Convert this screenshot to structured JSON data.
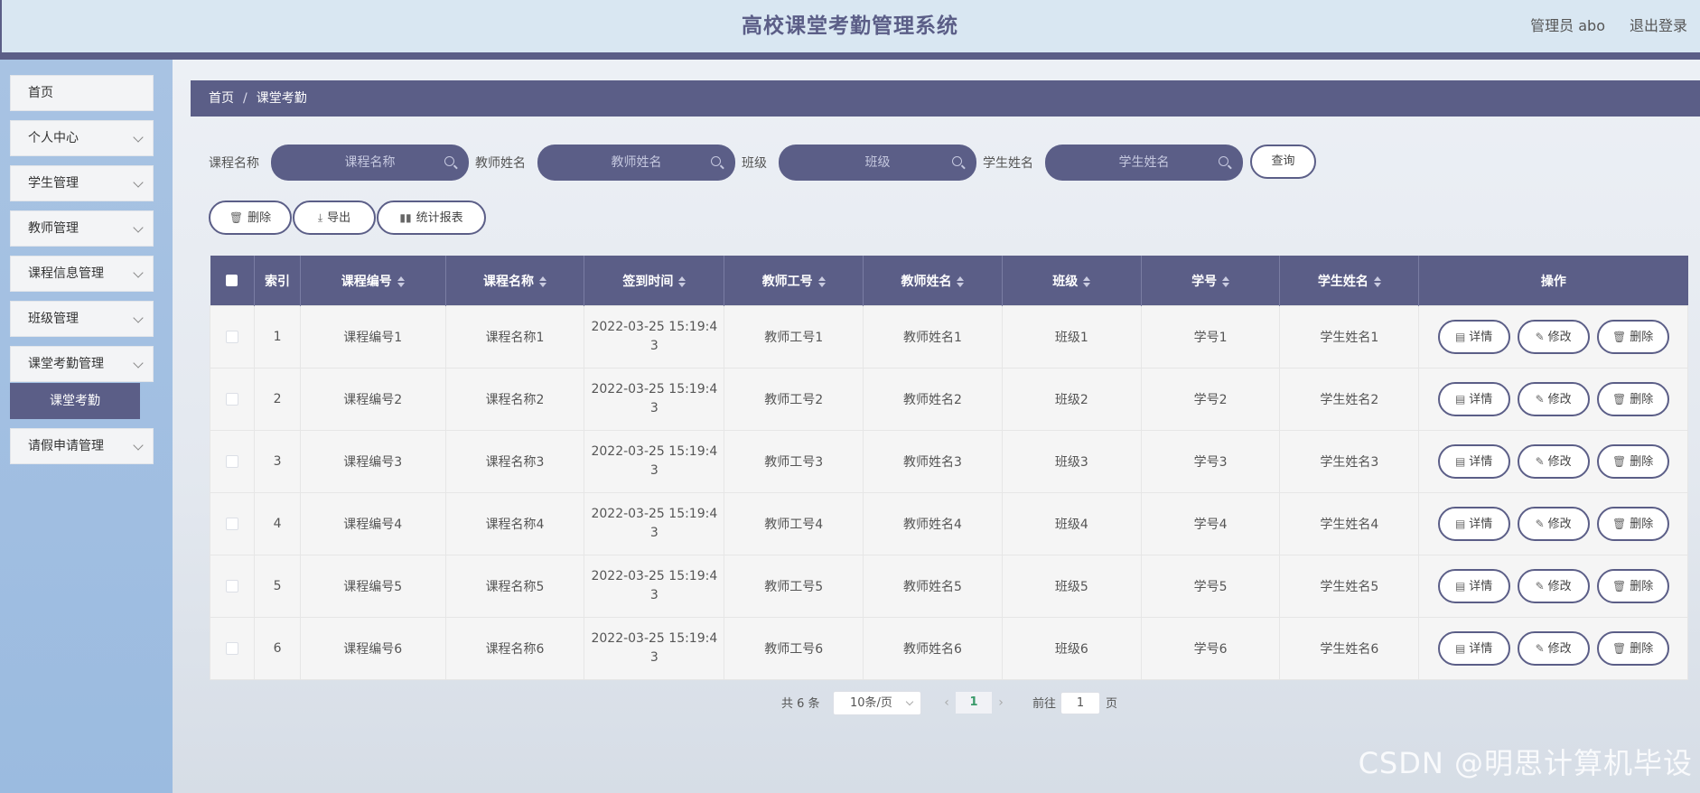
{
  "header": {
    "title": "高校课堂考勤管理系统",
    "admin": "管理员 abo",
    "logout": "退出登录"
  },
  "sidebar": {
    "items": [
      {
        "label": "首页",
        "has_arrow": false
      },
      {
        "label": "个人中心",
        "has_arrow": true
      },
      {
        "label": "学生管理",
        "has_arrow": true
      },
      {
        "label": "教师管理",
        "has_arrow": true
      },
      {
        "label": "课程信息管理",
        "has_arrow": true
      },
      {
        "label": "班级管理",
        "has_arrow": true
      },
      {
        "label": "课堂考勤管理",
        "has_arrow": true
      },
      {
        "label": "请假申请管理",
        "has_arrow": true
      }
    ],
    "sub_active": "课堂考勤"
  },
  "breadcrumb": {
    "home": "首页",
    "separator": "/",
    "current": "课堂考勤"
  },
  "search": {
    "course_name_label": "课程名称",
    "course_name_placeholder": "课程名称",
    "teacher_name_label": "教师姓名",
    "teacher_name_placeholder": "教师姓名",
    "class_label": "班级",
    "class_placeholder": "班级",
    "student_name_label": "学生姓名",
    "student_name_placeholder": "学生姓名",
    "query_button": "查询"
  },
  "actions": {
    "delete": "删除",
    "export": "导出",
    "report": "统计报表"
  },
  "table": {
    "headers": {
      "index": "索引",
      "course_code": "课程编号",
      "course_name": "课程名称",
      "signin_time": "签到时间",
      "teacher_id": "教师工号",
      "teacher_name": "教师姓名",
      "class": "班级",
      "student_id": "学号",
      "student_name": "学生姓名",
      "ops": "操作"
    },
    "rows": [
      {
        "index": "1",
        "course_code": "课程编号1",
        "course_name": "课程名称1",
        "time_a": "2022-03-25 15:19:4",
        "time_b": "3",
        "teacher_id": "教师工号1",
        "teacher_name": "教师姓名1",
        "class": "班级1",
        "student_id": "学号1",
        "student_name": "学生姓名1"
      },
      {
        "index": "2",
        "course_code": "课程编号2",
        "course_name": "课程名称2",
        "time_a": "2022-03-25 15:19:4",
        "time_b": "3",
        "teacher_id": "教师工号2",
        "teacher_name": "教师姓名2",
        "class": "班级2",
        "student_id": "学号2",
        "student_name": "学生姓名2"
      },
      {
        "index": "3",
        "course_code": "课程编号3",
        "course_name": "课程名称3",
        "time_a": "2022-03-25 15:19:4",
        "time_b": "3",
        "teacher_id": "教师工号3",
        "teacher_name": "教师姓名3",
        "class": "班级3",
        "student_id": "学号3",
        "student_name": "学生姓名3"
      },
      {
        "index": "4",
        "course_code": "课程编号4",
        "course_name": "课程名称4",
        "time_a": "2022-03-25 15:19:4",
        "time_b": "3",
        "teacher_id": "教师工号4",
        "teacher_name": "教师姓名4",
        "class": "班级4",
        "student_id": "学号4",
        "student_name": "学生姓名4"
      },
      {
        "index": "5",
        "course_code": "课程编号5",
        "course_name": "课程名称5",
        "time_a": "2022-03-25 15:19:4",
        "time_b": "3",
        "teacher_id": "教师工号5",
        "teacher_name": "教师姓名5",
        "class": "班级5",
        "student_id": "学号5",
        "student_name": "学生姓名5"
      },
      {
        "index": "6",
        "course_code": "课程编号6",
        "course_name": "课程名称6",
        "time_a": "2022-03-25 15:19:4",
        "time_b": "3",
        "teacher_id": "教师工号6",
        "teacher_name": "教师姓名6",
        "class": "班级6",
        "student_id": "学号6",
        "student_name": "学生姓名6"
      }
    ],
    "row_actions": {
      "detail": "详情",
      "edit": "修改",
      "delete": "删除"
    }
  },
  "pagination": {
    "total": "共 6 条",
    "page_size": "10条/页",
    "current_page": "1",
    "goto_label": "前往",
    "goto_value": "1",
    "page_suffix": "页"
  },
  "watermark": "CSDN @明思计算机毕设",
  "colors": {
    "primary": "#5b5e87",
    "header_bg": "#d9e7f2",
    "sidebar_bg": "#a8c3e3"
  },
  "icons": {
    "search": "search-icon",
    "trash": "trash-icon",
    "download": "download-icon",
    "bar_chart": "bar-chart-icon",
    "document": "document-icon",
    "pencil": "pencil-icon"
  }
}
